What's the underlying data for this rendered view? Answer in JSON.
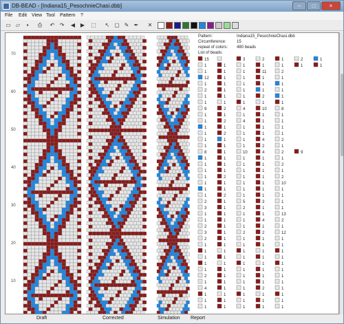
{
  "window": {
    "title": "DB-BEAD - [Indiana15_PesochnieChasi.dbb]",
    "buttons": [
      "–",
      "□",
      "×"
    ]
  },
  "menu": [
    "File",
    "Edit",
    "View",
    "Tool",
    "Pattern",
    "?"
  ],
  "toolbar": {
    "icons": [
      "new-icon",
      "open-icon",
      "save-icon",
      "print-icon",
      "undo-icon",
      "redo-icon",
      "arrow-left-icon",
      "arrow-right-icon",
      "preview-icon",
      "pointer-icon",
      "select-icon",
      "pencil-icon",
      "dropper-icon"
    ],
    "colors": [
      "#ffffff",
      "#8b1a1a",
      "#1a1a8b",
      "#2a7a2a",
      "#111111",
      "#1e88e5",
      "#8b1a8b",
      "#cccccc",
      "#99dd99",
      "#dddddd"
    ]
  },
  "ruler": {
    "labels": [
      "70",
      "60",
      "50",
      "40",
      "30",
      "20",
      "10"
    ]
  },
  "status": {
    "draft": "Draft",
    "corrected": "Corrected",
    "simulation": "Simulation",
    "report": "Report"
  },
  "report": {
    "pattern_label": "Pattern:",
    "pattern_value": "Indiana15_PesochnieChasi.dbb",
    "circumference_label": "Circumference:",
    "circumference_value": "15",
    "repeat_label": "repeat of colors:",
    "repeat_value": "480 beads",
    "list_label": "List of beads:",
    "rows": [
      [
        {
          "c": "dark",
          "n": "15"
        },
        {
          "c": "light",
          "n": ""
        },
        {
          "c": "dark",
          "n": "3"
        },
        {
          "c": "light",
          "n": "2"
        },
        {
          "c": "dark",
          "n": "1"
        },
        {
          "c": "light",
          "n": "2"
        },
        {
          "c": "blue",
          "n": "1"
        }
      ],
      [
        {
          "c": "light",
          "n": "1"
        },
        {
          "c": "dark",
          "n": "1"
        },
        {
          "c": "light",
          "n": "1"
        },
        {
          "c": "dark",
          "n": "1"
        },
        {
          "c": "light",
          "n": "1"
        },
        {
          "c": "dark",
          "n": "1"
        },
        {
          "c": "dark",
          "n": "1"
        }
      ],
      [
        {
          "c": "light",
          "n": "1"
        },
        {
          "c": "dark",
          "n": "1"
        },
        {
          "c": "light",
          "n": "1"
        },
        {
          "c": "dark",
          "n": "11"
        },
        {
          "c": "light",
          "n": "2"
        }
      ],
      [
        {
          "c": "blue",
          "n": "12"
        },
        {
          "c": "dark",
          "n": "1"
        },
        {
          "c": "light",
          "n": "1"
        },
        {
          "c": "dark",
          "n": "1"
        },
        {
          "c": "light",
          "n": "1"
        }
      ],
      [
        {
          "c": "light",
          "n": "1"
        },
        {
          "c": "dark",
          "n": "1"
        },
        {
          "c": "light",
          "n": "1"
        },
        {
          "c": "dark",
          "n": "1"
        },
        {
          "c": "blue",
          "n": "1"
        }
      ],
      [
        {
          "c": "light",
          "n": "2"
        },
        {
          "c": "dark",
          "n": "1"
        },
        {
          "c": "light",
          "n": "1"
        },
        {
          "c": "blue",
          "n": "1"
        },
        {
          "c": "light",
          "n": "1"
        }
      ],
      [
        {
          "c": "light",
          "n": "1"
        },
        {
          "c": "dark",
          "n": "1"
        },
        {
          "c": "light",
          "n": "1"
        },
        {
          "c": "dark",
          "n": "2"
        },
        {
          "c": "blue",
          "n": "1"
        }
      ],
      [
        {
          "c": "light",
          "n": "1"
        },
        {
          "c": "light",
          "n": "1"
        },
        {
          "c": "dark",
          "n": "1"
        },
        {
          "c": "light",
          "n": "1"
        },
        {
          "c": "dark",
          "n": "1"
        }
      ],
      [
        {
          "c": "light",
          "n": "9"
        },
        {
          "c": "dark",
          "n": "2"
        },
        {
          "c": "light",
          "n": "4"
        },
        {
          "c": "dark",
          "n": "10"
        },
        {
          "c": "light",
          "n": "8"
        }
      ],
      [
        {
          "c": "light",
          "n": "1"
        },
        {
          "c": "dark",
          "n": "1"
        },
        {
          "c": "light",
          "n": "1"
        },
        {
          "c": "dark",
          "n": "1"
        },
        {
          "c": "light",
          "n": "1"
        }
      ],
      [
        {
          "c": "light",
          "n": "1"
        },
        {
          "c": "dark",
          "n": "2"
        },
        {
          "c": "light",
          "n": "4"
        },
        {
          "c": "dark",
          "n": "1"
        },
        {
          "c": "light",
          "n": "1"
        }
      ],
      [
        {
          "c": "blue",
          "n": "1"
        },
        {
          "c": "dark",
          "n": "1"
        },
        {
          "c": "light",
          "n": "1"
        },
        {
          "c": "dark",
          "n": "1"
        },
        {
          "c": "light",
          "n": "1"
        }
      ],
      [
        {
          "c": "light",
          "n": "1"
        },
        {
          "c": "dark",
          "n": "2"
        },
        {
          "c": "light",
          "n": "1"
        },
        {
          "c": "dark",
          "n": "1"
        },
        {
          "c": "light",
          "n": "1"
        }
      ],
      [
        {
          "c": "light",
          "n": "1"
        },
        {
          "c": "blue",
          "n": "1"
        },
        {
          "c": "light",
          "n": "1"
        },
        {
          "c": "dark",
          "n": "4"
        },
        {
          "c": "light",
          "n": "2"
        }
      ],
      [
        {
          "c": "light",
          "n": "1"
        },
        {
          "c": "dark",
          "n": "1"
        },
        {
          "c": "light",
          "n": "1"
        },
        {
          "c": "dark",
          "n": "2"
        },
        {
          "c": "light",
          "n": "1"
        }
      ],
      [
        {
          "c": "light",
          "n": "8"
        },
        {
          "c": "dark",
          "n": "1"
        },
        {
          "c": "light",
          "n": "10"
        },
        {
          "c": "dark",
          "n": "4"
        },
        {
          "c": "light",
          "n": "2"
        },
        {
          "c": "dark",
          "n": "9"
        }
      ],
      [
        {
          "c": "blue",
          "n": "1"
        },
        {
          "c": "dark",
          "n": "1"
        },
        {
          "c": "light",
          "n": "1"
        },
        {
          "c": "dark",
          "n": "1"
        },
        {
          "c": "light",
          "n": "1"
        }
      ],
      [
        {
          "c": "light",
          "n": "1"
        },
        {
          "c": "dark",
          "n": "1"
        },
        {
          "c": "light",
          "n": "1"
        },
        {
          "c": "dark",
          "n": "1"
        },
        {
          "c": "light",
          "n": "2"
        }
      ],
      [
        {
          "c": "light",
          "n": "1"
        },
        {
          "c": "dark",
          "n": "1"
        },
        {
          "c": "light",
          "n": "1"
        },
        {
          "c": "dark",
          "n": "1"
        },
        {
          "c": "light",
          "n": "1"
        }
      ],
      [
        {
          "c": "light",
          "n": "1"
        },
        {
          "c": "dark",
          "n": "2"
        },
        {
          "c": "light",
          "n": "1"
        },
        {
          "c": "dark",
          "n": "1"
        },
        {
          "c": "light",
          "n": "2"
        }
      ],
      [
        {
          "c": "light",
          "n": "1"
        },
        {
          "c": "dark",
          "n": "1"
        },
        {
          "c": "light",
          "n": "1"
        },
        {
          "c": "dark",
          "n": "1"
        },
        {
          "c": "light",
          "n": "10"
        }
      ],
      [
        {
          "c": "blue",
          "n": "1"
        },
        {
          "c": "dark",
          "n": "1"
        },
        {
          "c": "light",
          "n": "1"
        },
        {
          "c": "dark",
          "n": "1"
        },
        {
          "c": "light",
          "n": "1"
        }
      ],
      [
        {
          "c": "light",
          "n": "1"
        },
        {
          "c": "dark",
          "n": "2"
        },
        {
          "c": "light",
          "n": "1"
        },
        {
          "c": "dark",
          "n": "1"
        },
        {
          "c": "light",
          "n": "1"
        }
      ],
      [
        {
          "c": "light",
          "n": "2"
        },
        {
          "c": "dark",
          "n": "1"
        },
        {
          "c": "light",
          "n": "5"
        },
        {
          "c": "dark",
          "n": "3"
        },
        {
          "c": "light",
          "n": "1"
        }
      ],
      [
        {
          "c": "light",
          "n": "3"
        },
        {
          "c": "dark",
          "n": "1"
        },
        {
          "c": "light",
          "n": "2"
        },
        {
          "c": "dark",
          "n": "1"
        },
        {
          "c": "light",
          "n": "1"
        }
      ],
      [
        {
          "c": "light",
          "n": "1"
        },
        {
          "c": "dark",
          "n": "1"
        },
        {
          "c": "light",
          "n": "1"
        },
        {
          "c": "dark",
          "n": "1"
        },
        {
          "c": "light",
          "n": "13"
        }
      ],
      [
        {
          "c": "light",
          "n": "1"
        },
        {
          "c": "dark",
          "n": "1"
        },
        {
          "c": "light",
          "n": "1"
        },
        {
          "c": "dark",
          "n": "4"
        },
        {
          "c": "light",
          "n": "2"
        }
      ],
      [
        {
          "c": "light",
          "n": "2"
        },
        {
          "c": "dark",
          "n": "1"
        },
        {
          "c": "light",
          "n": "1"
        },
        {
          "c": "dark",
          "n": "1"
        },
        {
          "c": "light",
          "n": "1"
        }
      ],
      [
        {
          "c": "light",
          "n": "3"
        },
        {
          "c": "dark",
          "n": "1"
        },
        {
          "c": "light",
          "n": "2"
        },
        {
          "c": "dark",
          "n": "2"
        },
        {
          "c": "light",
          "n": "12"
        }
      ],
      [
        {
          "c": "light",
          "n": "2"
        },
        {
          "c": "dark",
          "n": "1"
        },
        {
          "c": "light",
          "n": "1"
        },
        {
          "c": "dark",
          "n": "1"
        },
        {
          "c": "light",
          "n": "1"
        }
      ],
      [
        {
          "c": "light",
          "n": "1"
        },
        {
          "c": "dark",
          "n": "1"
        },
        {
          "c": "light",
          "n": "1"
        },
        {
          "c": "dark",
          "n": "1"
        },
        {
          "c": "light",
          "n": "1"
        }
      ],
      [
        {
          "c": "dark",
          "n": "1"
        },
        {
          "c": "light",
          "n": "1"
        },
        {
          "c": "dark",
          "n": "1"
        },
        {
          "c": "light",
          "n": "1"
        },
        {
          "c": "dark",
          "n": "1"
        }
      ],
      [
        {
          "c": "light",
          "n": "1"
        },
        {
          "c": "dark",
          "n": "1"
        },
        {
          "c": "light",
          "n": "1"
        },
        {
          "c": "dark",
          "n": "1"
        },
        {
          "c": "light",
          "n": "1"
        }
      ],
      [
        {
          "c": "dark",
          "n": "1"
        },
        {
          "c": "light",
          "n": "1"
        },
        {
          "c": "dark",
          "n": "1"
        },
        {
          "c": "light",
          "n": "1"
        },
        {
          "c": "dark",
          "n": "1"
        }
      ],
      [
        {
          "c": "light",
          "n": "1"
        },
        {
          "c": "dark",
          "n": "1"
        },
        {
          "c": "light",
          "n": "1"
        },
        {
          "c": "dark",
          "n": "1"
        },
        {
          "c": "light",
          "n": "1"
        }
      ],
      [
        {
          "c": "light",
          "n": "2"
        },
        {
          "c": "dark",
          "n": "1"
        },
        {
          "c": "light",
          "n": "1"
        },
        {
          "c": "dark",
          "n": "1"
        },
        {
          "c": "light",
          "n": "1"
        }
      ],
      [
        {
          "c": "light",
          "n": "1"
        },
        {
          "c": "dark",
          "n": "1"
        },
        {
          "c": "light",
          "n": "1"
        },
        {
          "c": "dark",
          "n": "1"
        },
        {
          "c": "light",
          "n": "1"
        }
      ],
      [
        {
          "c": "light",
          "n": "4"
        },
        {
          "c": "dark",
          "n": "1"
        },
        {
          "c": "light",
          "n": "1"
        },
        {
          "c": "dark",
          "n": "2"
        },
        {
          "c": "light",
          "n": "1"
        }
      ],
      [
        {
          "c": "dark",
          "n": "1"
        },
        {
          "c": "light",
          "n": "1"
        },
        {
          "c": "dark",
          "n": "1"
        },
        {
          "c": "light",
          "n": "1"
        },
        {
          "c": "dark",
          "n": "1"
        }
      ],
      [
        {
          "c": "light",
          "n": "1"
        },
        {
          "c": "dark",
          "n": "1"
        },
        {
          "c": "light",
          "n": "1"
        },
        {
          "c": "dark",
          "n": "1"
        },
        {
          "c": "light",
          "n": "1"
        }
      ],
      [
        {
          "c": "light",
          "n": "1"
        },
        {
          "c": "dark",
          "n": "1"
        },
        {
          "c": "light",
          "n": "1"
        },
        {
          "c": "dark",
          "n": "1"
        },
        {
          "c": "light",
          "n": "1"
        }
      ]
    ]
  },
  "palette": {
    "dark": "#8b1a1a",
    "light": "#e6e6e6",
    "blue": "#1e88e5",
    "outline": "#555555"
  }
}
